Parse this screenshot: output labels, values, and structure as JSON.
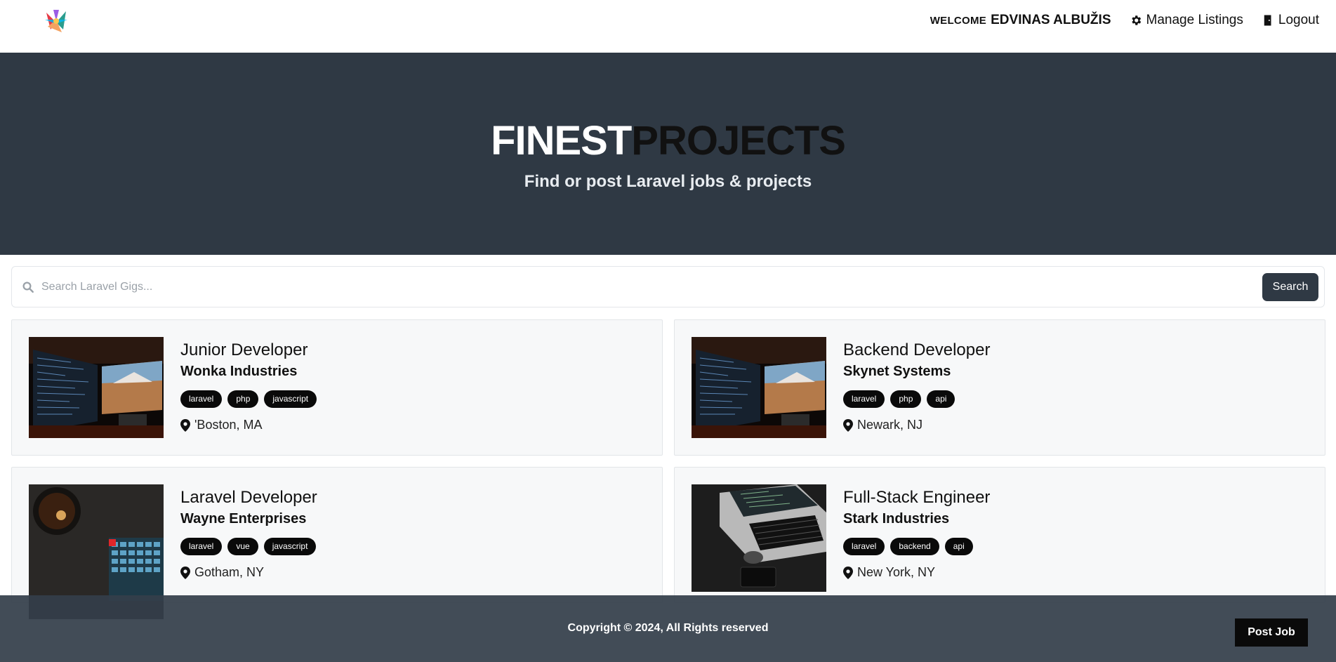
{
  "nav": {
    "logo_alt": "logo",
    "welcome_label": "Welcome",
    "username": "Edvinas Albužis",
    "manage_label": "Manage Listings",
    "logout_label": "Logout"
  },
  "hero": {
    "title_part1": "FINEST",
    "title_part2": "PROJECTS",
    "subtitle": "Find or post Laravel jobs & projects"
  },
  "search": {
    "placeholder": "Search Laravel Gigs...",
    "button_label": "Search"
  },
  "listings": [
    {
      "title": "Junior Developer",
      "company": "Wonka Industries",
      "tags": [
        "laravel",
        "php",
        "javascript"
      ],
      "location": "'Boston, MA"
    },
    {
      "title": "Backend Developer",
      "company": "Skynet Systems",
      "tags": [
        "laravel",
        "php",
        "api"
      ],
      "location": "Newark, NJ"
    },
    {
      "title": "Laravel Developer",
      "company": "Wayne Enterprises",
      "tags": [
        "laravel",
        "vue",
        "javascript"
      ],
      "location": "Gotham, NY"
    },
    {
      "title": "Full-Stack Engineer",
      "company": "Stark Industries",
      "tags": [
        "laravel",
        "backend",
        "api"
      ],
      "location": "New York, NY"
    }
  ],
  "footer": {
    "copyright": "Copyright © 2024, All Rights reserved",
    "post_job_label": "Post Job"
  },
  "colors": {
    "hero_bg": "#2f3944",
    "tag_bg": "#0a0a0a",
    "footer_bg": "#343e4a"
  }
}
